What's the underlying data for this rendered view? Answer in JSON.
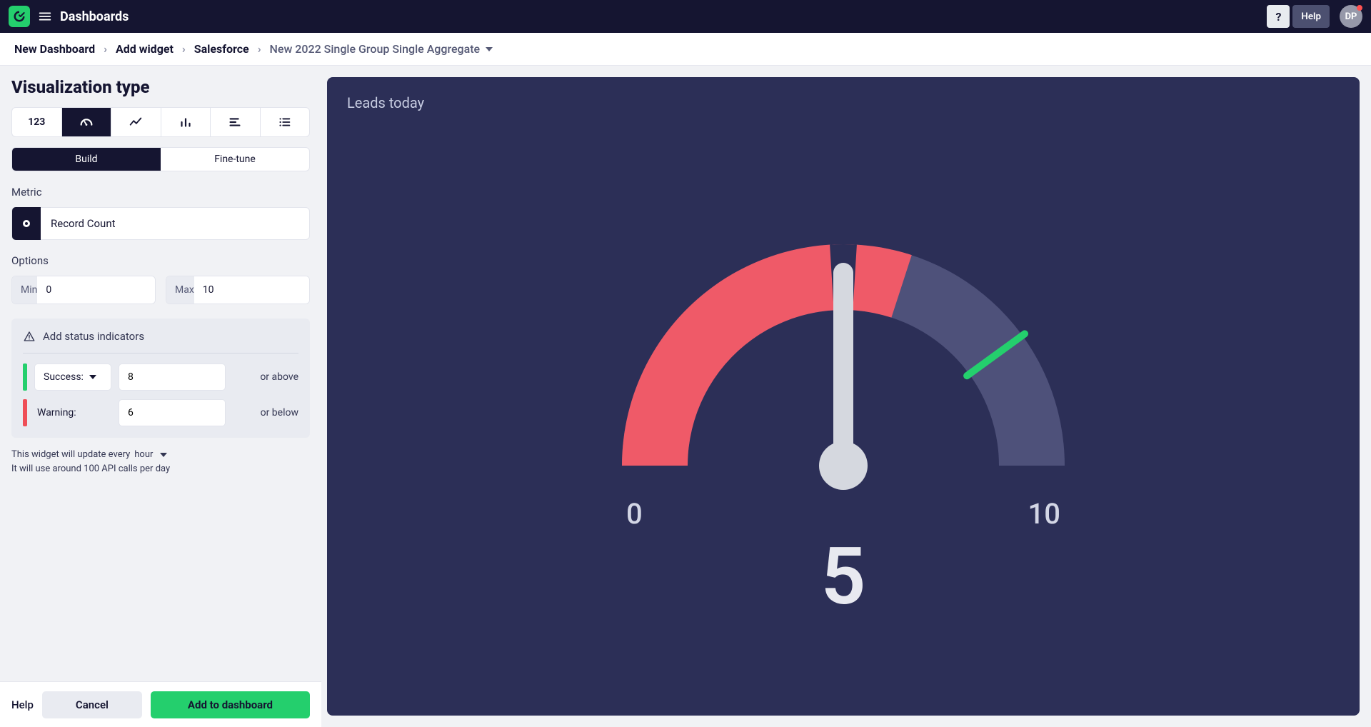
{
  "header": {
    "title": "Dashboards",
    "help_label": "Help",
    "question_mark": "?",
    "avatar_initials": "DP"
  },
  "breadcrumbs": {
    "items": [
      "New Dashboard",
      "Add widget",
      "Salesforce"
    ],
    "last": "New 2022 Single Group Single Aggregate"
  },
  "sidebar": {
    "heading": "Visualization type",
    "viz_types": [
      {
        "name": "number",
        "label": "123"
      },
      {
        "name": "gauge",
        "label": "gauge-icon",
        "selected": true
      },
      {
        "name": "line",
        "label": "line-icon"
      },
      {
        "name": "bar",
        "label": "bar-icon"
      },
      {
        "name": "hbar",
        "label": "hbar-icon"
      },
      {
        "name": "list",
        "label": "list-icon"
      }
    ],
    "segment": {
      "build": "Build",
      "fine": "Fine-tune",
      "selected": "build"
    },
    "metric_label": "Metric",
    "metric_value": "Record Count",
    "options_label": "Options",
    "min_label": "Min",
    "min_value": "0",
    "max_label": "Max",
    "max_value": "10",
    "status_heading": "Add status indicators",
    "success": {
      "label": "Success:",
      "value": "8",
      "suffix": "or above",
      "color": "#24cf6d"
    },
    "warning": {
      "label": "Warning:",
      "value": "6",
      "suffix": "or below",
      "color": "#ef4e57"
    },
    "update": {
      "prefix": "This widget will update every",
      "interval": "hour",
      "line2": "It will use around 100 API calls per day"
    },
    "actions": {
      "help": "Help",
      "cancel": "Cancel",
      "add": "Add to dashboard"
    }
  },
  "preview": {
    "title": "Leads today"
  },
  "chart_data": {
    "type": "gauge",
    "value": 5,
    "min": 0,
    "max": 10,
    "title": "Leads today",
    "thresholds": {
      "success_at_or_above": 8,
      "warning_at_or_below": 6
    },
    "colors": {
      "warning_arc": "#ef5a68",
      "track": "#4e517a",
      "success_tick": "#24cf6d",
      "needle": "#d5d8df"
    },
    "min_label": "0",
    "max_label": "10",
    "value_label": "5"
  }
}
